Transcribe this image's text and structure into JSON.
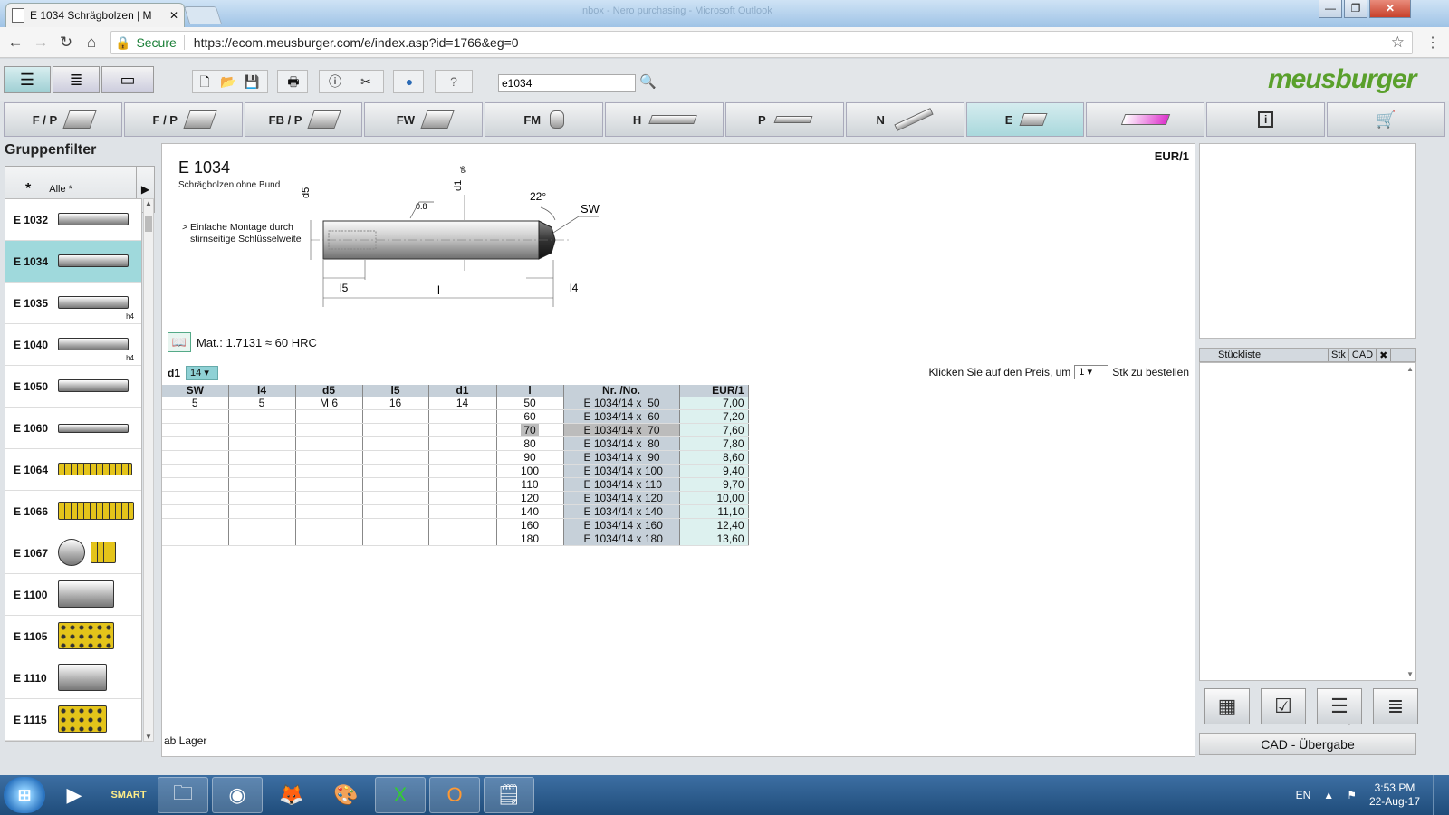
{
  "browser": {
    "tab_title": "E 1034 Schrägbolzen | M",
    "tab_close": "✕",
    "window_title": "Inbox - Nero purchasing - Microsoft Outlook",
    "window_buttons": [
      "—",
      "❐",
      "✕"
    ],
    "secure_label": "Secure",
    "url": "https://ecom.meusburger.com/e/index.asp?id=1766&eg=0"
  },
  "toolbar": {
    "search_value": "e1034",
    "logo": "meusburger"
  },
  "category_tabs": [
    {
      "label": "F / P",
      "active": false
    },
    {
      "label": "F / P",
      "active": false
    },
    {
      "label": "FB / P",
      "active": false
    },
    {
      "label": "FW",
      "active": false
    },
    {
      "label": "FM",
      "active": false
    },
    {
      "label": "H",
      "active": false
    },
    {
      "label": "P",
      "active": false
    },
    {
      "label": "N",
      "active": false
    },
    {
      "label": "E",
      "active": true
    },
    {
      "label": "",
      "active": false
    },
    {
      "label": "i",
      "active": false
    },
    {
      "label": "",
      "active": false
    }
  ],
  "sidebar": {
    "title": "Gruppenfilter",
    "alle_symbol": "*",
    "alle_label": "Alle *",
    "items": [
      {
        "code": "E 1032",
        "note": ""
      },
      {
        "code": "E 1034",
        "note": ""
      },
      {
        "code": "E 1035",
        "note": "h4"
      },
      {
        "code": "E 1040",
        "note": "h4"
      },
      {
        "code": "E 1050",
        "note": ""
      },
      {
        "code": "E 1060",
        "note": ""
      },
      {
        "code": "E 1064",
        "note": ""
      },
      {
        "code": "E 1066",
        "note": ""
      },
      {
        "code": "E 1067",
        "note": ""
      },
      {
        "code": "E 1100",
        "note": ""
      },
      {
        "code": "E 1105",
        "note": ""
      },
      {
        "code": "E 1110",
        "note": ""
      },
      {
        "code": "E 1115",
        "note": ""
      }
    ],
    "selected": "E 1034"
  },
  "product": {
    "code": "E 1034",
    "subtitle": "Schrägbolzen ohne Bund",
    "description_line1": "> Einfache Montage durch",
    "description_line2": "stirnseitige Schlüsselweite",
    "currency_unit": "EUR/1",
    "material": "Mat.: 1.7131  ≈ 60 HRC",
    "d1_label": "d1",
    "d1_value": "14",
    "order_hint_pre": "Klicken Sie auf den Preis, um",
    "order_qty": "1",
    "order_hint_post": "Stk zu bestellen",
    "stock_note": "ab Lager",
    "drawing_labels": {
      "d5": "d5",
      "d1": "d1",
      "d1_tol": "g6",
      "roughness": "0.8",
      "angle": "22°",
      "sw": "SW",
      "l5": "l5",
      "l4": "l4",
      "l": "l"
    }
  },
  "table": {
    "headers": [
      "SW",
      "l4",
      "d5",
      "l5",
      "d1",
      "l",
      "Nr. /No.",
      "EUR/1"
    ],
    "rows": [
      [
        "5",
        "5",
        "M  6",
        "16",
        "14",
        "50",
        "E 1034/14 x  50",
        "7,00"
      ],
      [
        "",
        "",
        "",
        "",
        "",
        "60",
        "E 1034/14 x  60",
        "7,20"
      ],
      [
        "",
        "",
        "",
        "",
        "",
        "70",
        "E 1034/14 x  70",
        "7,60"
      ],
      [
        "",
        "",
        "",
        "",
        "",
        "80",
        "E 1034/14 x  80",
        "7,80"
      ],
      [
        "",
        "",
        "",
        "",
        "",
        "90",
        "E 1034/14 x  90",
        "8,60"
      ],
      [
        "",
        "",
        "",
        "",
        "",
        "100",
        "E 1034/14 x 100",
        "9,40"
      ],
      [
        "",
        "",
        "",
        "",
        "",
        "110",
        "E 1034/14 x 110",
        "9,70"
      ],
      [
        "",
        "",
        "",
        "",
        "",
        "120",
        "E 1034/14 x 120",
        "10,00"
      ],
      [
        "",
        "",
        "",
        "",
        "",
        "140",
        "E 1034/14 x 140",
        "11,10"
      ],
      [
        "",
        "",
        "",
        "",
        "",
        "160",
        "E 1034/14 x 160",
        "12,40"
      ],
      [
        "",
        "",
        "",
        "",
        "",
        "180",
        "E 1034/14 x 180",
        "13,60"
      ]
    ],
    "highlighted_row": 2
  },
  "right_panel": {
    "columns": [
      "Stückliste",
      "Stk",
      "CAD"
    ],
    "cad_button": "CAD - Übergabe"
  },
  "taskbar": {
    "language": "EN",
    "time": "3:53 PM",
    "date": "22-Aug-17",
    "apps": [
      "media-player",
      "smart",
      "explorer",
      "chrome",
      "firefox",
      "paint",
      "excel",
      "outlook",
      "notepad"
    ]
  }
}
